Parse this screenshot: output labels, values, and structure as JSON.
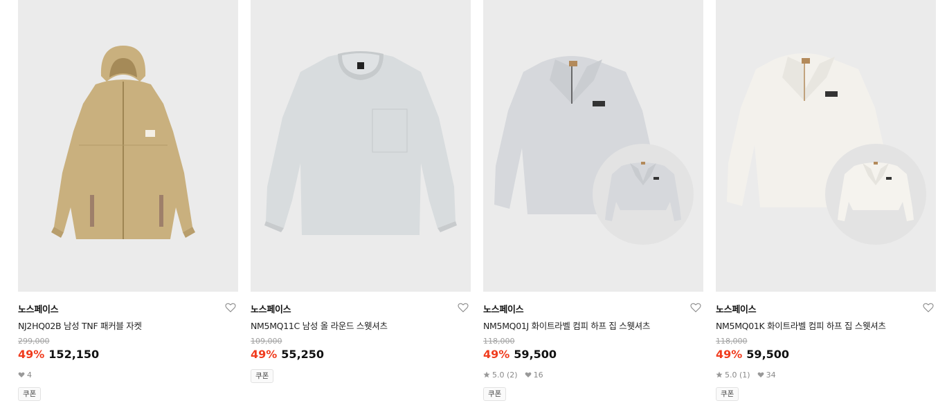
{
  "products": [
    {
      "brand": "노스페이스",
      "title": "NJ2HQ02B 남성 TNF 패커블 자켓",
      "original_price": "299,000",
      "discount": "49%",
      "price": "152,150",
      "likes": "4",
      "coupon": "쿠폰",
      "color": "#c9b07e"
    },
    {
      "brand": "노스페이스",
      "title": "NM5MQ11C 남성 올 라운드 스웻셔츠",
      "original_price": "109,000",
      "discount": "49%",
      "price": "55,250",
      "coupon": "쿠폰",
      "color": "#d8dcde"
    },
    {
      "brand": "노스페이스",
      "title": "NM5MQ01J 화이트라벨 컴피 하프 집 스웻셔츠",
      "original_price": "118,000",
      "discount": "49%",
      "price": "59,500",
      "rating": "5.0 (2)",
      "likes": "16",
      "coupon": "쿠폰",
      "color": "#d6d8dc"
    },
    {
      "brand": "노스페이스",
      "title": "NM5MQ01K 화이트라벨 컴피 하프 집 스웻셔츠",
      "original_price": "118,000",
      "discount": "49%",
      "price": "59,500",
      "rating": "5.0 (1)",
      "likes": "34",
      "coupon": "쿠폰",
      "color": "#f3f1ec"
    }
  ],
  "icons": {
    "heart": "heart-outline-icon",
    "like": "heart-filled-icon",
    "rating": "star-icon"
  },
  "colors": {
    "discount": "#f03c1e",
    "thumb_bg": "#ebebeb"
  }
}
